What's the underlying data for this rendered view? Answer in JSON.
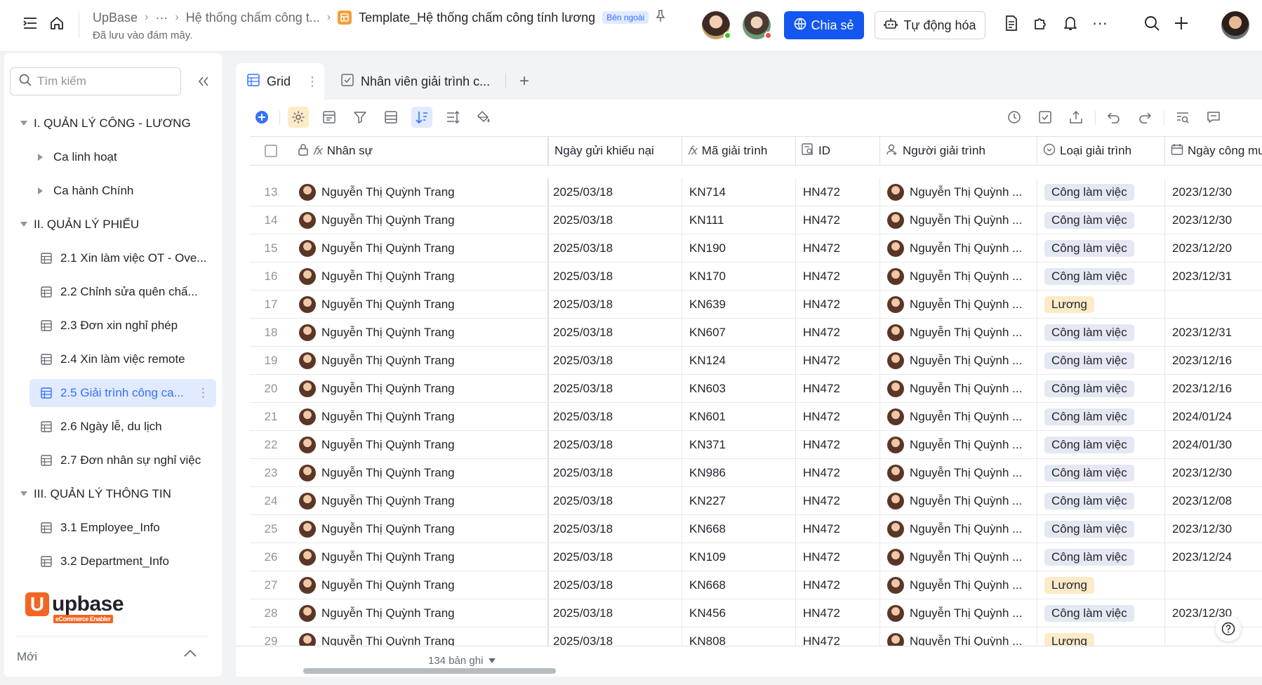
{
  "topbar": {
    "breadcrumb_root": "UpBase",
    "breadcrumb_more": "···",
    "breadcrumb_parent": "Hệ thống chấm công t...",
    "breadcrumb_current": "Template_Hệ thống chấm công tính lương",
    "external_badge": "Bên ngoài",
    "saved_status": "Đã lưu vào đám mây.",
    "share_label": "Chia sẻ",
    "automation_label": "Tự động hóa",
    "accent": "#1456f0"
  },
  "sidebar": {
    "search_placeholder": "Tìm kiếm",
    "sections": [
      {
        "label": "I. QUẢN LÝ CÔNG - LƯƠNG"
      },
      {
        "label": "II. QUẢN LÝ PHIẾU"
      },
      {
        "label": "III. QUẢN LÝ THÔNG TIN"
      }
    ],
    "sub_items": [
      "Ca linh hoạt",
      "Ca hành Chính"
    ],
    "tables": [
      "2.1 Xin làm việc OT - Ove...",
      "2.2 Chỉnh sửa quên chấ...",
      "2.3 Đơn xin nghỉ phép",
      "2.4 Xin làm việc remote",
      "2.5 Giải trình công ca...",
      "2.6 Ngày lễ, du lịch",
      "2.7 Đơn nhân sự nghỉ việc",
      "3.1 Employee_Info",
      "3.2 Department_Info"
    ],
    "logo_text": "upbase",
    "logo_tagline": "eCommerce Enabler",
    "new_label": "Mới"
  },
  "tabs": {
    "grid_label": "Grid",
    "second_label": "Nhân viên giải trình c..."
  },
  "columns": {
    "name": "Nhân sự",
    "date": "Ngày gửi khiếu nại",
    "code": "Mã giải trình",
    "id": "ID",
    "person": "Người giải trình",
    "type": "Loại giải trình",
    "want": "Ngày công muốn g"
  },
  "rows": [
    {
      "n": "13",
      "name": "Nguyễn Thị Quỳnh Trang",
      "date": "2025/03/18",
      "code": "KN714",
      "id": "HN472",
      "person": "Nguyễn Thị Quỳnh ...",
      "type": "Công làm việc",
      "want": "2023/12/30"
    },
    {
      "n": "14",
      "name": "Nguyễn Thị Quỳnh Trang",
      "date": "2025/03/18",
      "code": "KN111",
      "id": "HN472",
      "person": "Nguyễn Thị Quỳnh ...",
      "type": "Công làm việc",
      "want": "2023/12/30"
    },
    {
      "n": "15",
      "name": "Nguyễn Thị Quỳnh Trang",
      "date": "2025/03/18",
      "code": "KN190",
      "id": "HN472",
      "person": "Nguyễn Thị Quỳnh ...",
      "type": "Công làm việc",
      "want": "2023/12/20"
    },
    {
      "n": "16",
      "name": "Nguyễn Thị Quỳnh Trang",
      "date": "2025/03/18",
      "code": "KN170",
      "id": "HN472",
      "person": "Nguyễn Thị Quỳnh ...",
      "type": "Công làm việc",
      "want": "2023/12/31"
    },
    {
      "n": "17",
      "name": "Nguyễn Thị Quỳnh Trang",
      "date": "2025/03/18",
      "code": "KN639",
      "id": "HN472",
      "person": "Nguyễn Thị Quỳnh ...",
      "type": "Lương",
      "want": ""
    },
    {
      "n": "18",
      "name": "Nguyễn Thị Quỳnh Trang",
      "date": "2025/03/18",
      "code": "KN607",
      "id": "HN472",
      "person": "Nguyễn Thị Quỳnh ...",
      "type": "Công làm việc",
      "want": "2023/12/31"
    },
    {
      "n": "19",
      "name": "Nguyễn Thị Quỳnh Trang",
      "date": "2025/03/18",
      "code": "KN124",
      "id": "HN472",
      "person": "Nguyễn Thị Quỳnh ...",
      "type": "Công làm việc",
      "want": "2023/12/16"
    },
    {
      "n": "20",
      "name": "Nguyễn Thị Quỳnh Trang",
      "date": "2025/03/18",
      "code": "KN603",
      "id": "HN472",
      "person": "Nguyễn Thị Quỳnh ...",
      "type": "Công làm việc",
      "want": "2023/12/16"
    },
    {
      "n": "21",
      "name": "Nguyễn Thị Quỳnh Trang",
      "date": "2025/03/18",
      "code": "KN601",
      "id": "HN472",
      "person": "Nguyễn Thị Quỳnh ...",
      "type": "Công làm việc",
      "want": "2024/01/24"
    },
    {
      "n": "22",
      "name": "Nguyễn Thị Quỳnh Trang",
      "date": "2025/03/18",
      "code": "KN371",
      "id": "HN472",
      "person": "Nguyễn Thị Quỳnh ...",
      "type": "Công làm việc",
      "want": "2024/01/30"
    },
    {
      "n": "23",
      "name": "Nguyễn Thị Quỳnh Trang",
      "date": "2025/03/18",
      "code": "KN986",
      "id": "HN472",
      "person": "Nguyễn Thị Quỳnh ...",
      "type": "Công làm việc",
      "want": "2023/12/30"
    },
    {
      "n": "24",
      "name": "Nguyễn Thị Quỳnh Trang",
      "date": "2025/03/18",
      "code": "KN227",
      "id": "HN472",
      "person": "Nguyễn Thị Quỳnh ...",
      "type": "Công làm việc",
      "want": "2023/12/08"
    },
    {
      "n": "25",
      "name": "Nguyễn Thị Quỳnh Trang",
      "date": "2025/03/18",
      "code": "KN668",
      "id": "HN472",
      "person": "Nguyễn Thị Quỳnh ...",
      "type": "Công làm việc",
      "want": "2023/12/30"
    },
    {
      "n": "26",
      "name": "Nguyễn Thị Quỳnh Trang",
      "date": "2025/03/18",
      "code": "KN109",
      "id": "HN472",
      "person": "Nguyễn Thị Quỳnh ...",
      "type": "Công làm việc",
      "want": "2023/12/24"
    },
    {
      "n": "27",
      "name": "Nguyễn Thị Quỳnh Trang",
      "date": "2025/03/18",
      "code": "KN668",
      "id": "HN472",
      "person": "Nguyễn Thị Quỳnh ...",
      "type": "Lương",
      "want": ""
    },
    {
      "n": "28",
      "name": "Nguyễn Thị Quỳnh Trang",
      "date": "2025/03/18",
      "code": "KN456",
      "id": "HN472",
      "person": "Nguyễn Thị Quỳnh ...",
      "type": "Công làm việc",
      "want": "2023/12/30"
    },
    {
      "n": "29",
      "name": "Nguyễn Thị Quỳnh Trang",
      "date": "2025/03/18",
      "code": "KN808",
      "id": "HN472",
      "person": "Nguyễn Thị Quỳnh ...",
      "type": "Lương",
      "want": ""
    }
  ],
  "footer": {
    "record_count": "134 bản ghi"
  }
}
